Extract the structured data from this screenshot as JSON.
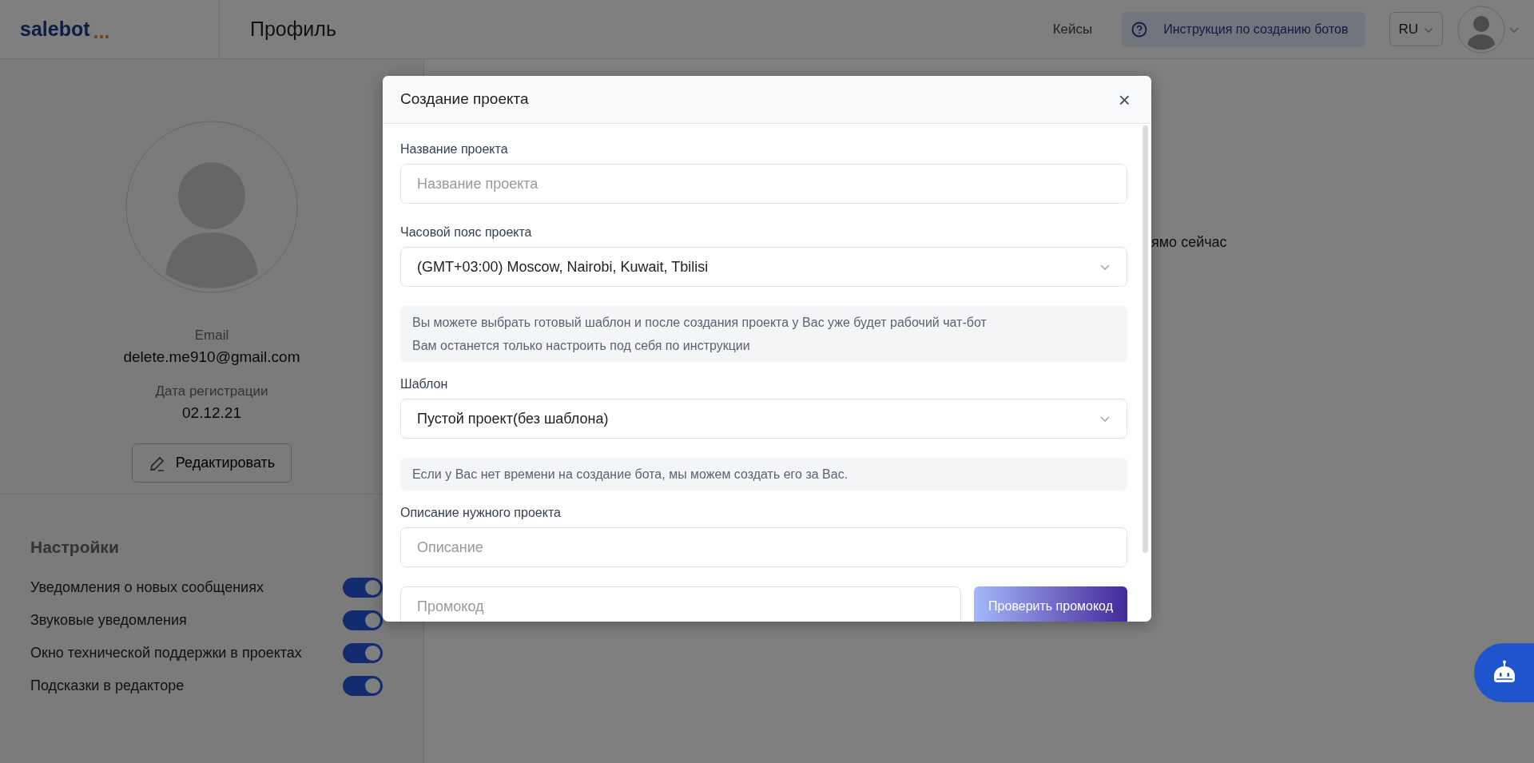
{
  "header": {
    "logo": "salebot",
    "logo_dots": "...",
    "page_title": "Профиль",
    "links": [
      {
        "label": "Кейсы"
      }
    ],
    "help_button": "Инструкция по созданию ботов",
    "language": "RU"
  },
  "profile": {
    "email_label": "Email",
    "email": "delete.me910@gmail.com",
    "date_label": "Дата регистрации",
    "date": "02.12.21",
    "edit_button": "Редактировать"
  },
  "settings": {
    "title": "Настройки",
    "items": [
      {
        "label": "Уведомления о новых сообщениях",
        "on": true
      },
      {
        "label": "Звуковые уведомления",
        "on": true
      },
      {
        "label": "Окно технической поддержки в проектах",
        "on": true
      },
      {
        "label": "Подсказки в редакторе",
        "on": true
      }
    ]
  },
  "main": {
    "partial_text": "ямо сейчас"
  },
  "modal": {
    "title": "Создание проекта",
    "close": "×",
    "items": [
      {
        "kind": "input",
        "label": "Название проекта",
        "placeholder": "Название проекта"
      },
      {
        "kind": "select",
        "label": "Часовой пояс проекта",
        "value": "(GMT+03:00) Moscow, Nairobi, Kuwait, Tbilisi"
      },
      {
        "kind": "note",
        "lines": [
          "Вы можете выбрать готовый шаблон и после создания проекта у Вас уже будет рабочий чат-бот",
          "Вам останется только настроить под себя по инструкции"
        ]
      },
      {
        "kind": "select",
        "label": "Шаблон",
        "value": "Пустой проект(без шаблона)"
      },
      {
        "kind": "note",
        "lines": [
          "Если у Вас нет времени на создание бота, мы можем создать его за Вас."
        ]
      },
      {
        "kind": "input",
        "label": "Описание нужного проекта",
        "placeholder": "Описание"
      },
      {
        "kind": "promo",
        "placeholder": "Промокод",
        "button": "Проверить промокод"
      }
    ]
  }
}
